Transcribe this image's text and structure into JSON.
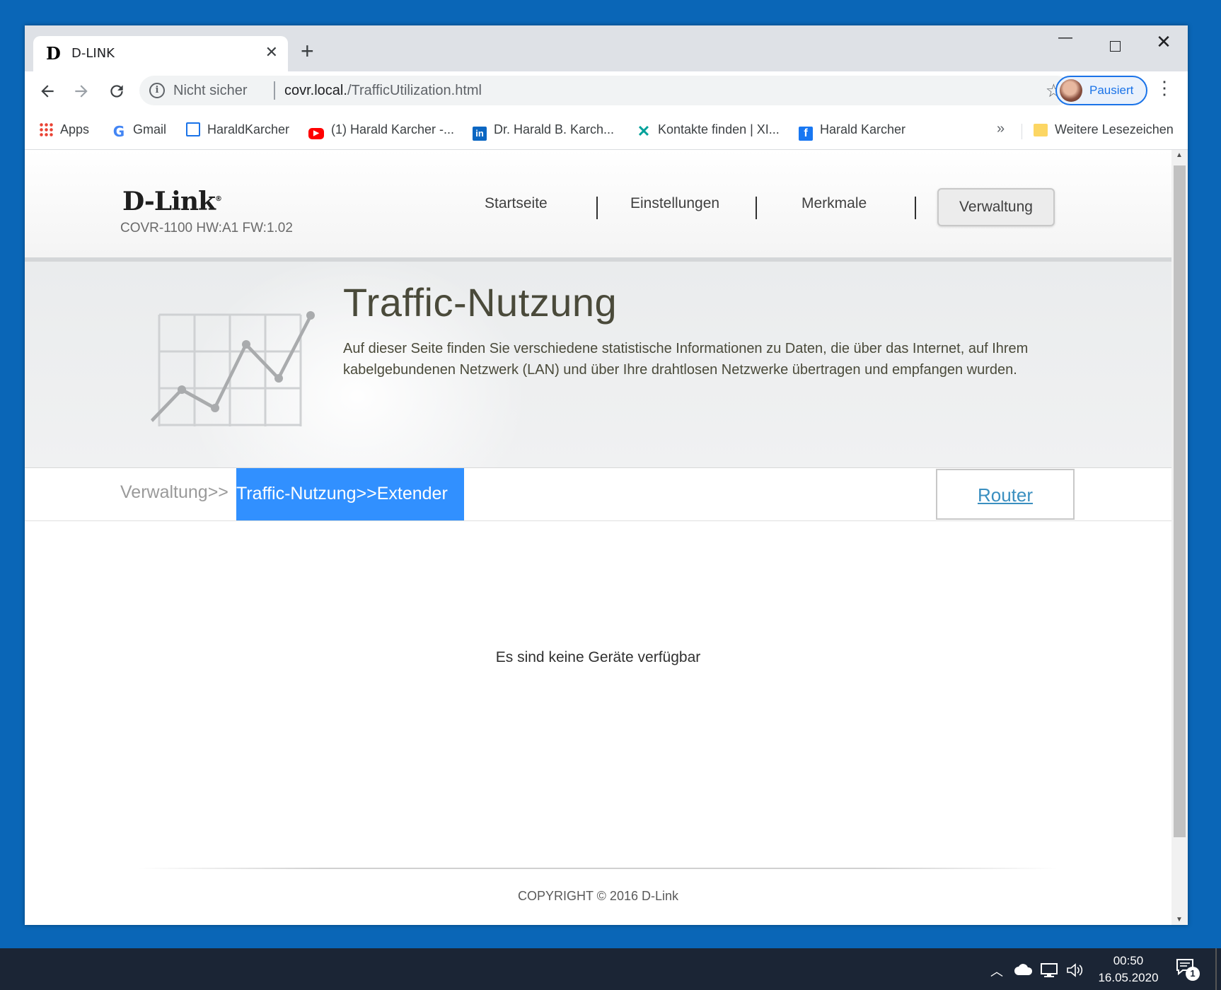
{
  "browser": {
    "tab_title": "D-LINK",
    "tab_favicon_letter": "D",
    "tab_close": "✕",
    "new_tab": "+",
    "window_minimize": "—",
    "window_close": "✕",
    "not_secure": "Nicht sicher",
    "url_host": "covr.local.",
    "url_path": "/TrafficUtilization.html",
    "profile_label": "Pausiert",
    "bookmarks": [
      {
        "label": "Apps",
        "icon": "apps-grid-icon"
      },
      {
        "label": "Gmail",
        "icon": "google-icon"
      },
      {
        "label": "HaraldKarcher",
        "icon": "calendar-icon"
      },
      {
        "label": "(1) Harald Karcher -...",
        "icon": "youtube-icon"
      },
      {
        "label": "Dr. Harald B. Karch...",
        "icon": "linkedin-icon"
      },
      {
        "label": "Kontakte finden | XI...",
        "icon": "xing-icon"
      },
      {
        "label": "Harald Karcher",
        "icon": "facebook-icon"
      }
    ],
    "bookmarks_more": "»",
    "other_bookmarks": "Weitere Lesezeichen"
  },
  "page": {
    "logo": "D-Link",
    "model": "COVR-1100 HW:A1 FW:1.02",
    "nav": [
      "Startseite",
      "Einstellungen",
      "Merkmale",
      "Verwaltung"
    ],
    "title": "Traffic-Nutzung",
    "description": "Auf dieser Seite finden Sie verschiedene statistische Informationen zu Daten, die über das Internet, auf Ihrem kabelgebundenen Netzwerk (LAN) und über Ihre drahtlosen Netzwerke übertragen und empfangen wurden.",
    "breadcrumb_parent": "Verwaltung>>",
    "breadcrumb_current": "Traffic-Nutzung>>Extender",
    "router_link": "Router",
    "empty_message": "Es sind keine Geräte verfügbar",
    "copyright": "COPYRIGHT © 2016 D-Link"
  },
  "taskbar": {
    "time": "00:50",
    "date": "16.05.2020",
    "notification_count": "1"
  },
  "colors": {
    "breadcrumb_active": "#3190ff",
    "router_link": "#3a8fc0",
    "desktop": "#0a66b7"
  }
}
